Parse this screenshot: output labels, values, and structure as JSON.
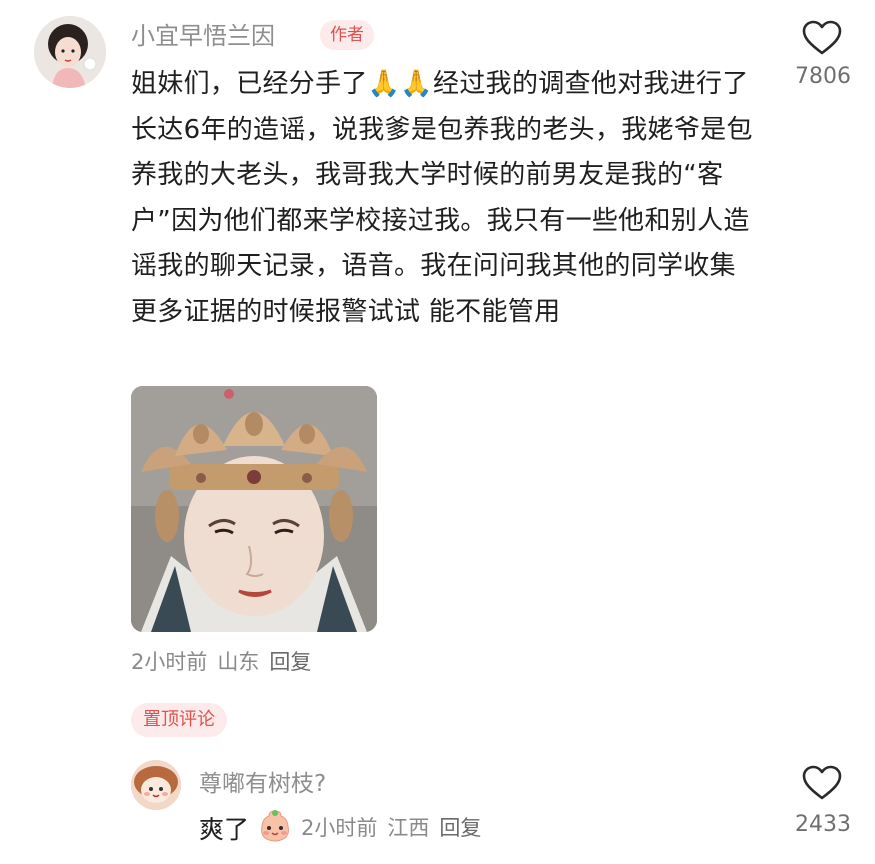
{
  "comment": {
    "username": "小宜早悟兰因",
    "author_badge": "作者",
    "text": "姐妹们，已经分手了🙏🙏经过我的调查他对我进行了长达6年的造谣，说我爹是包养我的老头，我姥爷是包养我的大老头，我哥我大学时候的前男友是我的“客户”因为他们都来学校接过我。我只有一些他和别人造谣我的聊天记录，语音。我在问问我其他的同学收集更多证据的时候报警试试 能不能管用",
    "like_count": "7806",
    "time": "2小时前",
    "location": "山东",
    "reply_label": "回复",
    "image_icon": "statue-photo"
  },
  "pinned_badge": "置顶评论",
  "reply": {
    "username": "尊嘟有树枝?",
    "text": "爽了",
    "emoji_icon": "smile-face-emoji",
    "time": "2小时前",
    "location": "江西",
    "reply_label": "回复",
    "like_count": "2433"
  },
  "colors": {
    "accent_red": "#e0524f",
    "badge_bg": "#fdeaea",
    "meta_gray": "#8a8a8a"
  }
}
